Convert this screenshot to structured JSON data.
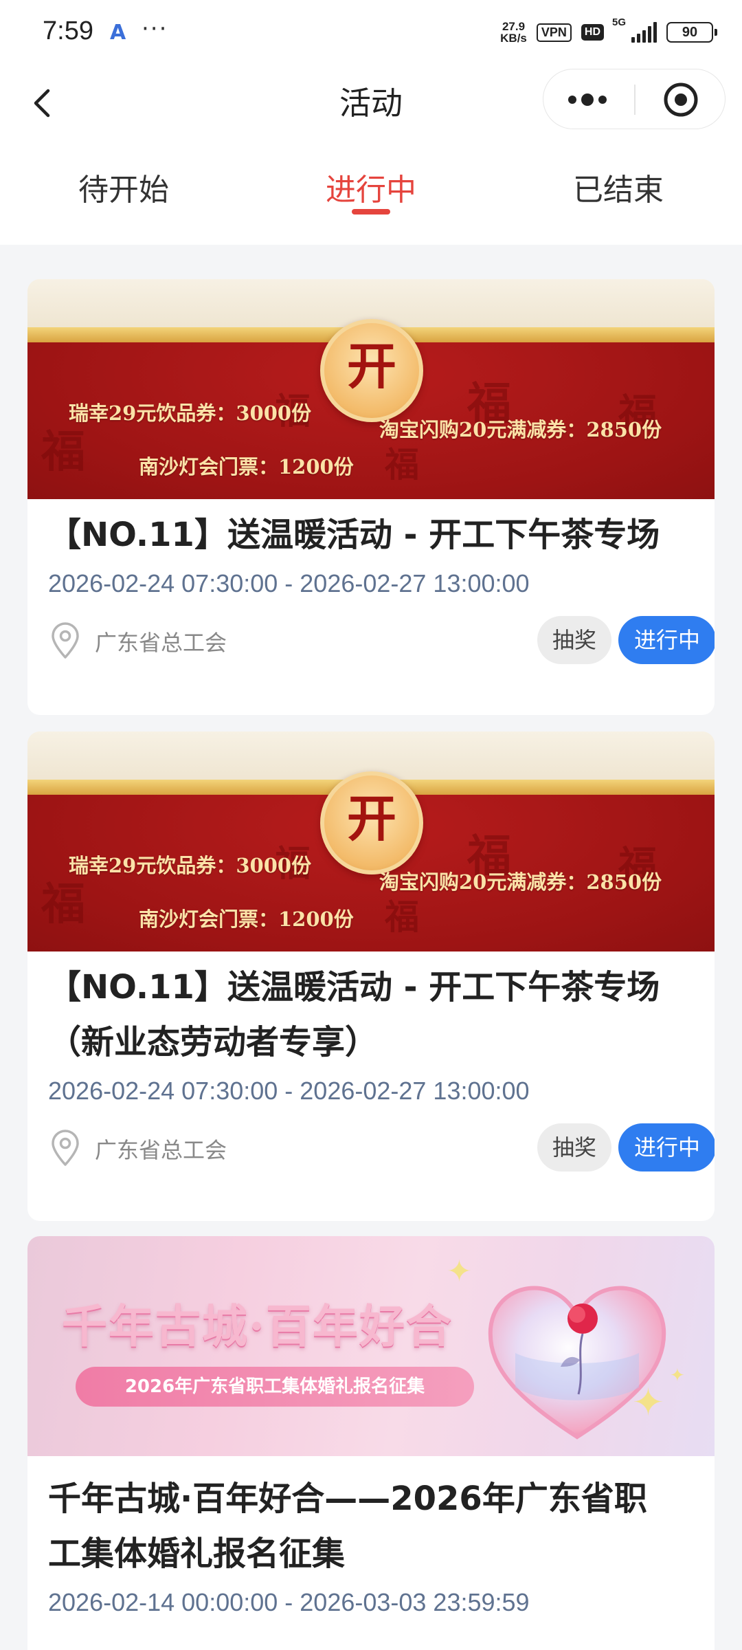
{
  "status_bar": {
    "time": "7:59",
    "app_glyph": "A",
    "more_glyph": "···",
    "net_speed_value": "27.9",
    "net_speed_unit": "KB/s",
    "vpn_label": "VPN",
    "hd_label": "HD",
    "signal_label": "5G",
    "battery_level": "90"
  },
  "nav": {
    "title": "活动"
  },
  "tabs": [
    {
      "label": "待开始",
      "active": false
    },
    {
      "label": "进行中",
      "active": true
    },
    {
      "label": "已结束",
      "active": false
    }
  ],
  "cards": [
    {
      "banner": {
        "seal_char": "开",
        "prize_1": "瑞幸29元饮品券：3000份",
        "prize_2": "淘宝闪购20元满减券：2850份",
        "prize_3": "南沙灯会门票：1200份"
      },
      "title": "【NO.11】送温暖活动 - 开工下午茶专场",
      "time": "2026-02-24 07:30:00 - 2026-02-27 13:00:00",
      "location": "广东省总工会",
      "type_tag": "抽奖",
      "status_tag": "进行中"
    },
    {
      "banner": {
        "seal_char": "开",
        "prize_1": "瑞幸29元饮品券：3000份",
        "prize_2": "淘宝闪购20元满减券：2850份",
        "prize_3": "南沙灯会门票：1200份"
      },
      "title_line1": "【NO.11】送温暖活动 - 开工下午茶专场",
      "title_line2": "（新业态劳动者专享）",
      "time": "2026-02-24 07:30:00 - 2026-02-27 13:00:00",
      "location": "广东省总工会",
      "type_tag": "抽奖",
      "status_tag": "进行中"
    },
    {
      "banner": {
        "headline": "千年古城·百年好合",
        "subtitle": "2026年广东省职工集体婚礼报名征集"
      },
      "title_line1": "千年古城·百年好合——2026年广东省职",
      "title_line2": "工集体婚礼报名征集",
      "time": "2026-02-14 00:00:00 - 2026-03-03 23:59:59"
    }
  ],
  "colors": {
    "accent_red": "#e5443d",
    "status_blue": "#2f7df0",
    "time_text": "#5f7290",
    "banner_red": "#9d1414",
    "banner_gold": "#f3d37a"
  },
  "icons": [
    "back-arrow-icon",
    "more-dots-icon",
    "close-target-icon",
    "location-pin-icon"
  ]
}
